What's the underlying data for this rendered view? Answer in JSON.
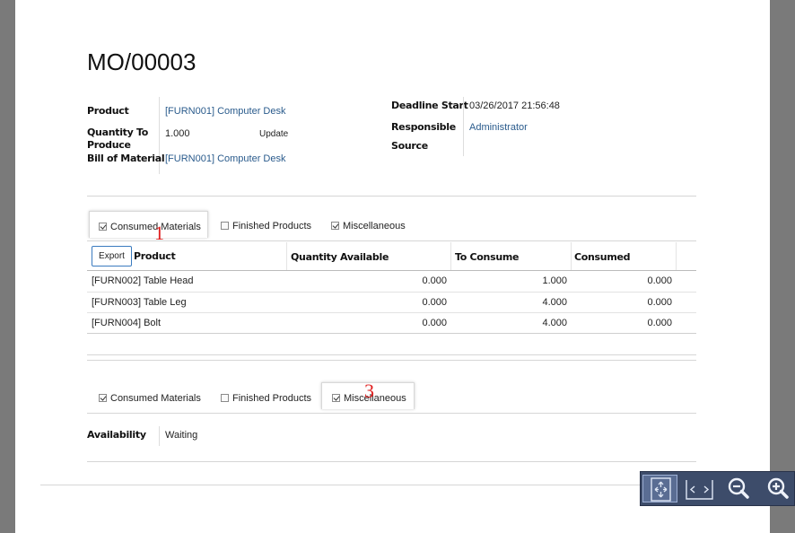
{
  "record": {
    "title": "MO/00003"
  },
  "fields_left": {
    "product_label": "Product",
    "product_value": "[FURN001] Computer Desk",
    "qty_label_1": "Quantity To",
    "qty_label_2": "Produce",
    "qty_value": "1.000",
    "update_label": "Update",
    "bom_label": "Bill of Material",
    "bom_value": "[FURN001] Computer Desk"
  },
  "fields_right": {
    "deadline_label": "Deadline Start",
    "deadline_value": "03/26/2017 21:56:48",
    "responsible_label": "Responsible",
    "responsible_value": "Administrator",
    "source_label": "Source"
  },
  "tabs_top": {
    "consumed": "Consumed Materials",
    "finished": "Finished Products",
    "misc": "Miscellaneous"
  },
  "tabs_bottom": {
    "consumed": "Consumed Materials",
    "finished": "Finished Products",
    "misc": "Miscellaneous"
  },
  "annotations": {
    "one": "1",
    "three": "3"
  },
  "table": {
    "export_label": "Export",
    "headers": [
      "Product",
      "Quantity Available",
      "To Consume",
      "Consumed"
    ],
    "rows": [
      [
        "[FURN002] Table Head",
        "0.000",
        "1.000",
        "0.000"
      ],
      [
        "[FURN003] Table Leg",
        "0.000",
        "4.000",
        "0.000"
      ],
      [
        "[FURN004] Bolt",
        "0.000",
        "4.000",
        "0.000"
      ]
    ]
  },
  "misc": {
    "availability_label": "Availability",
    "availability_value": "Waiting"
  },
  "toolbar": {
    "icons": [
      "fit-page-icon",
      "fit-width-icon",
      "zoom-out-icon",
      "zoom-in-icon"
    ],
    "accent": "#3d4c6a"
  }
}
